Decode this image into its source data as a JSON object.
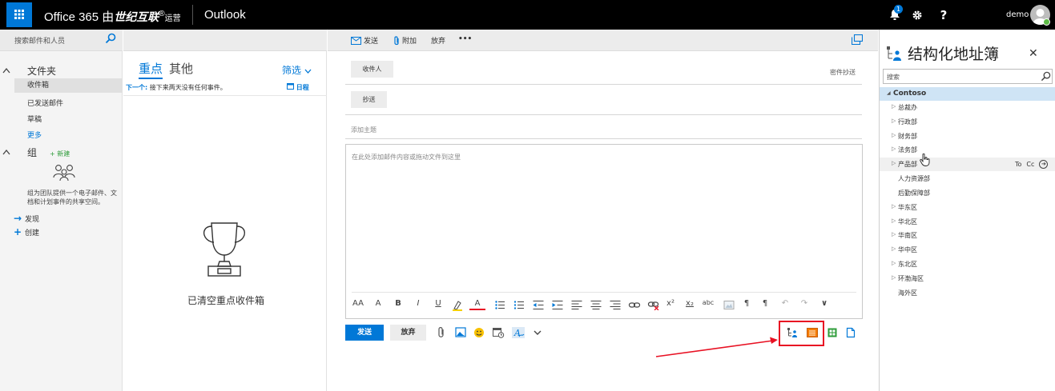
{
  "topbar": {
    "brand_prefix": "Office 365 由",
    "brand_bold": "世纪互联",
    "brand_suffix": "运营",
    "brand_mark": "®",
    "app_name": "Outlook",
    "notification_count": "1",
    "help_label": "?",
    "user_name": "demo"
  },
  "leftnav": {
    "search_placeholder": "搜索邮件和人员",
    "folders_heading": "文件夹",
    "folders": [
      "收件箱",
      "已发送邮件",
      "草稿"
    ],
    "more": "更多",
    "groups_heading": "组",
    "new_link": "新建",
    "groups_desc": "组为团队提供一个电子邮件、文档和计划事件的共享空间。",
    "discover": "发现",
    "create": "创建"
  },
  "msglist": {
    "tab_focused": "重点",
    "tab_other": "其他",
    "filter": "筛选",
    "next_label": "下一个:",
    "next_text": "接下来两天没有任何事件。",
    "agenda": "日程",
    "empty_text": "已清空重点收件箱"
  },
  "compose": {
    "cmd_send": "发送",
    "cmd_attach": "附加",
    "cmd_discard": "放弃",
    "cmd_more": "•••",
    "to_label": "收件人",
    "cc_label": "抄送",
    "bcc_label": "密件抄送",
    "subject_placeholder": "添加主题",
    "body_placeholder": "在此处添加邮件内容或拖动文件到这里",
    "format_tools": [
      "AA",
      "A",
      "B",
      "I",
      "U",
      "",
      "A",
      "",
      "",
      "",
      "",
      "",
      "",
      "",
      "",
      "",
      "x²",
      "x₂",
      "abc",
      "",
      "¶",
      "¶",
      "↶",
      "↷",
      "∨"
    ],
    "send_button": "发送",
    "discard_button": "放弃"
  },
  "addressbook": {
    "title": "结构化地址簿",
    "search_placeholder": "搜索",
    "root": "Contoso",
    "items": [
      {
        "label": "总裁办",
        "expandable": true
      },
      {
        "label": "行政部",
        "expandable": true
      },
      {
        "label": "财务部",
        "expandable": true
      },
      {
        "label": "法务部",
        "expandable": true
      },
      {
        "label": "产品部",
        "expandable": true
      },
      {
        "label": "人力资源部",
        "expandable": false
      },
      {
        "label": "后勤保障部",
        "expandable": false
      },
      {
        "label": "华东区",
        "expandable": true
      },
      {
        "label": "华北区",
        "expandable": true
      },
      {
        "label": "华南区",
        "expandable": true
      },
      {
        "label": "华中区",
        "expandable": true
      },
      {
        "label": "东北区",
        "expandable": true
      },
      {
        "label": "环渤海区",
        "expandable": true
      },
      {
        "label": "海外区",
        "expandable": false
      }
    ],
    "row_to": "To",
    "row_cc": "Cc"
  },
  "colors": {
    "accent": "#0078d7",
    "topbar": "#000000",
    "highlight": "#e81123",
    "selected_row": "#cfe4f5"
  }
}
